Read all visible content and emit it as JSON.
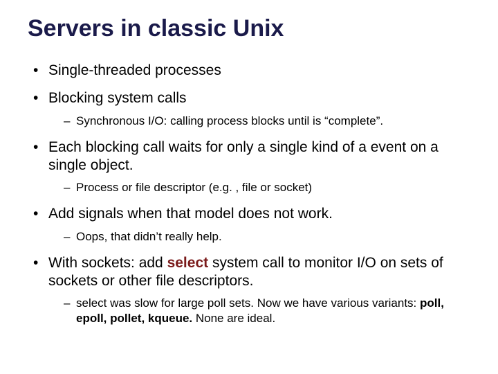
{
  "title": "Servers in classic Unix",
  "b1": "Single-threaded processes",
  "b2": "Blocking system calls",
  "b2s1": "Synchronous I/O: calling process blocks until is “complete”.",
  "b3": "Each blocking call waits for only a single kind of a event on a single object.",
  "b3s1": "Process or file descriptor (e.g. , file or socket)",
  "b4": "Add signals when that model does not work.",
  "b4s1": "Oops, that didn’t really help.",
  "b5_pre": "With sockets: add ",
  "b5_sel": "select",
  "b5_post": " system call to monitor I/O on sets of sockets or other file descriptors.",
  "b5s1_pre": "select was slow for large poll sets.  Now we have various variants: ",
  "b5s1_bold": "poll, epoll, pollet, kqueue.",
  "b5s1_post": "   None are ideal."
}
